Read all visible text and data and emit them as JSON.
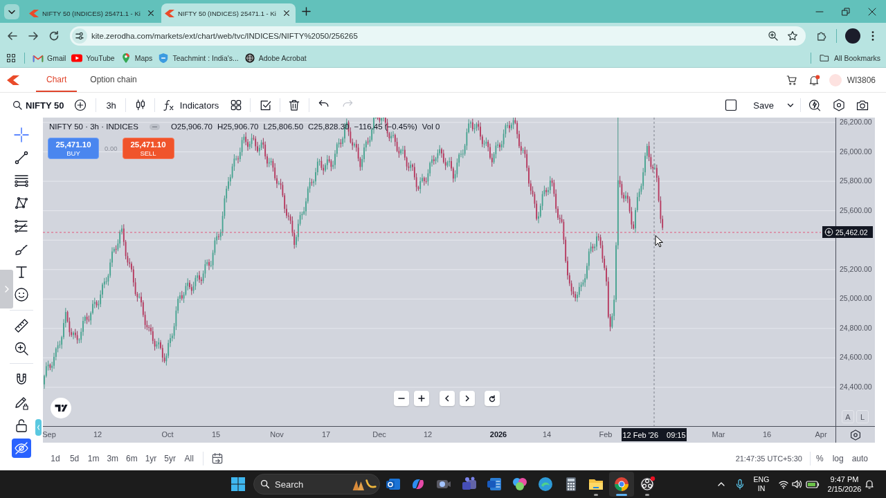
{
  "browser": {
    "tabs": [
      {
        "title": "NIFTY 50 (INDICES) 25471.1 - Ki",
        "selected": false
      },
      {
        "title": "NIFTY 50 (INDICES) 25471.1 - Ki",
        "selected": true
      }
    ],
    "url": "kite.zerodha.com/markets/ext/chart/web/tvc/INDICES/NIFTY%2050/256265",
    "bookmarks": [
      "Gmail",
      "YouTube",
      "Maps",
      "Teachmint : India's...",
      "Adobe Acrobat"
    ],
    "all_bookmarks": "All Bookmarks"
  },
  "app_header": {
    "tabs": [
      {
        "label": "Chart",
        "selected": true
      },
      {
        "label": "Option chain",
        "selected": false
      }
    ],
    "unread_notifications": true,
    "user_id": "WI3806"
  },
  "chart_toolbar": {
    "symbol": "NIFTY 50",
    "interval": "3h",
    "indicators": "Indicators",
    "history": [
      {
        "disabled": false
      },
      {
        "disabled": true
      }
    ],
    "save": "Save"
  },
  "legend": {
    "title": "NIFTY 50 · 3h · INDICES",
    "values": [
      "O25,906.70",
      "H25,906.70",
      "L25,806.50",
      "C25,828.30",
      "−116.45 (−0.45%)",
      "Vol 0"
    ]
  },
  "trade": {
    "buy": {
      "price": "25,471.10",
      "label": "BUY"
    },
    "spread": "0.00",
    "sell": {
      "price": "25,471.10",
      "label": "SELL"
    }
  },
  "left_toolbar": {
    "tools": [
      {
        "selected": true
      },
      {
        "selected": false
      },
      {
        "selected": false
      },
      {
        "selected": false
      },
      {
        "selected": false
      },
      {
        "selected": false
      },
      {
        "selected": false
      },
      {
        "selected": false
      },
      {
        "selected": false
      },
      {
        "selected": false
      }
    ],
    "toggles": [
      {
        "on": false
      },
      {
        "on": false
      },
      {
        "on": false
      },
      {
        "on": true
      }
    ]
  },
  "price_axis": {
    "labels": [
      "26,200.00",
      "26,000.00",
      "25,800.00",
      "25,600.00",
      "25,200.00",
      "25,000.00",
      "24,800.00",
      "24,600.00",
      "24,400.00"
    ],
    "crosshair": "25,462.02",
    "buttons": [
      "A",
      "L"
    ]
  },
  "time_axis": {
    "labels": [
      {
        "text": "Sep",
        "major": false
      },
      {
        "text": "12",
        "major": false
      },
      {
        "text": "Oct",
        "major": false
      },
      {
        "text": "15",
        "major": false
      },
      {
        "text": "Nov",
        "major": false
      },
      {
        "text": "17",
        "major": false
      },
      {
        "text": "Dec",
        "major": false
      },
      {
        "text": "12",
        "major": false
      },
      {
        "text": "2026",
        "major": true
      },
      {
        "text": "14",
        "major": false
      },
      {
        "text": "Feb",
        "major": false
      },
      {
        "text": "Mar",
        "major": false
      },
      {
        "text": "16",
        "major": false
      },
      {
        "text": "Apr",
        "major": false
      }
    ],
    "crosshair": {
      "date": "12 Feb '26",
      "time": "09:15"
    }
  },
  "ranges": [
    "1d",
    "5d",
    "1m",
    "3m",
    "6m",
    "1yr",
    "5yr",
    "All"
  ],
  "status": {
    "clock": "21:47:35 UTC+5:30",
    "options": [
      "%",
      "log",
      "auto"
    ]
  },
  "taskbar": {
    "search": {
      "placeholder": "Search"
    },
    "apps": [
      {
        "running": false,
        "active": false
      },
      {
        "running": false,
        "active": false
      },
      {
        "running": false,
        "active": false
      },
      {
        "running": false,
        "active": false
      },
      {
        "running": false,
        "active": false
      },
      {
        "running": false,
        "active": false
      },
      {
        "running": false,
        "active": false
      },
      {
        "running": false,
        "active": false
      },
      {
        "running": true,
        "active": false
      },
      {
        "running": true,
        "active": true
      },
      {
        "running": true,
        "active": false
      }
    ],
    "language": [
      "ENG",
      "IN"
    ],
    "time": "9:47 PM",
    "date": "2/15/2026"
  }
}
